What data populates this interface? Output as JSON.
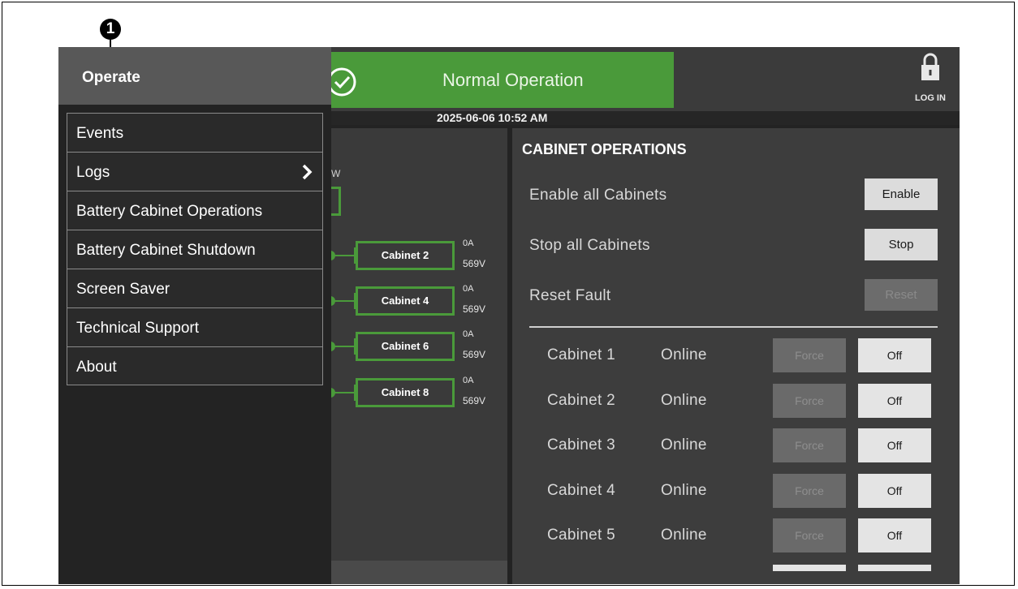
{
  "callout": {
    "number": "1"
  },
  "status": {
    "text": "Normal Operation",
    "color": "#4a9a3a"
  },
  "login": {
    "label": "LOG IN",
    "icon": "lock-icon"
  },
  "datetime": "2025-06-06 10:52 AM",
  "left_panel": {
    "power_unit_label": "W",
    "cabinets": [
      {
        "name": "Cabinet 2",
        "current": "0A",
        "voltage": "569V"
      },
      {
        "name": "Cabinet 4",
        "current": "0A",
        "voltage": "569V"
      },
      {
        "name": "Cabinet 6",
        "current": "0A",
        "voltage": "569V"
      },
      {
        "name": "Cabinet 8",
        "current": "0A",
        "voltage": "569V"
      }
    ]
  },
  "cabinet_operations": {
    "title": "CABINET OPERATIONS",
    "actions": [
      {
        "label": "Enable all Cabinets",
        "button": "Enable",
        "enabled": true
      },
      {
        "label": "Stop all Cabinets",
        "button": "Stop",
        "enabled": true
      },
      {
        "label": "Reset Fault",
        "button": "Reset",
        "enabled": false
      }
    ],
    "cabinets": [
      {
        "name": "Cabinet 1",
        "status": "Online",
        "force": "Force",
        "off": "Off"
      },
      {
        "name": "Cabinet 2",
        "status": "Online",
        "force": "Force",
        "off": "Off"
      },
      {
        "name": "Cabinet 3",
        "status": "Online",
        "force": "Force",
        "off": "Off"
      },
      {
        "name": "Cabinet 4",
        "status": "Online",
        "force": "Force",
        "off": "Off"
      },
      {
        "name": "Cabinet 5",
        "status": "Online",
        "force": "Force",
        "off": "Off"
      }
    ]
  },
  "menu": {
    "title": "Operate",
    "items": [
      {
        "label": "Events",
        "submenu": false
      },
      {
        "label": "Logs",
        "submenu": true
      },
      {
        "label": "Battery Cabinet Operations",
        "submenu": false
      },
      {
        "label": "Battery Cabinet Shutdown",
        "submenu": false
      },
      {
        "label": "Screen Saver",
        "submenu": false
      },
      {
        "label": "Technical Support",
        "submenu": false
      },
      {
        "label": "About",
        "submenu": false
      }
    ]
  }
}
